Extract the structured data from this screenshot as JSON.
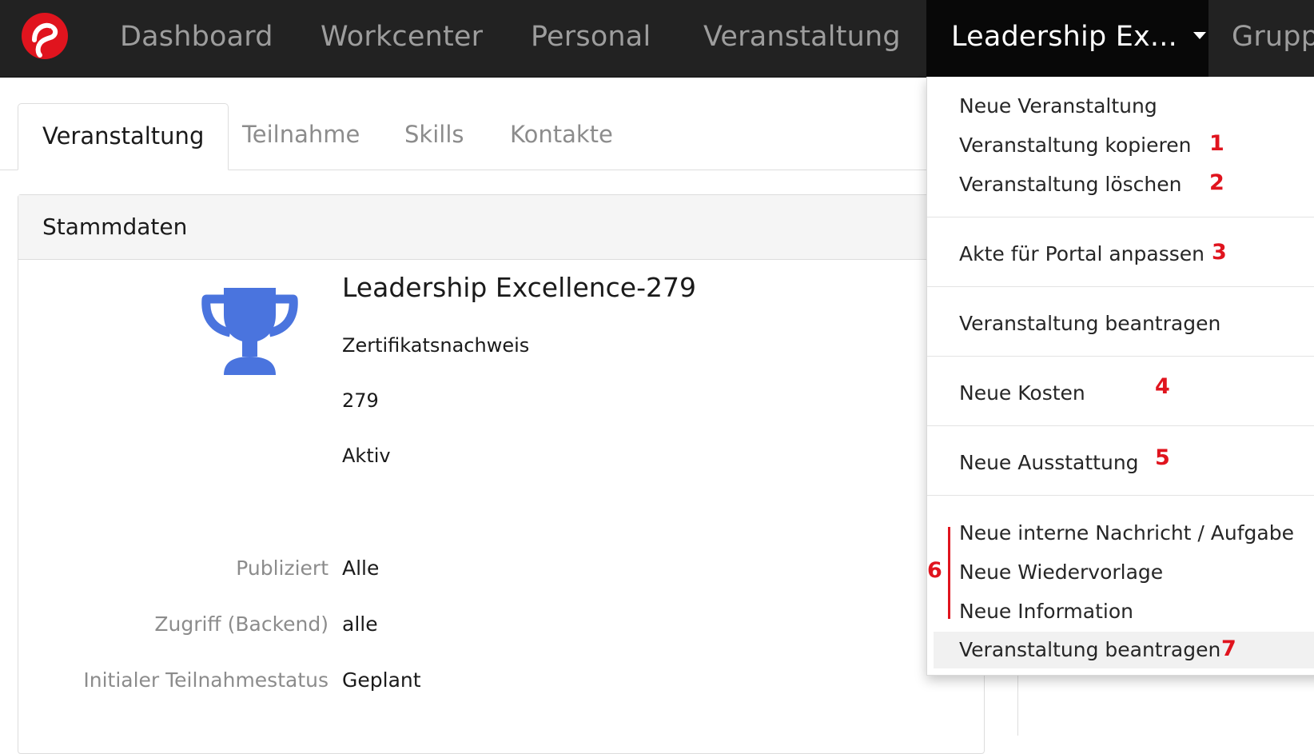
{
  "topnav": {
    "items": [
      {
        "label": "Dashboard"
      },
      {
        "label": "Workcenter"
      },
      {
        "label": "Personal"
      },
      {
        "label": "Veranstaltung"
      },
      {
        "label": "Leadership Ex..."
      },
      {
        "label": "Grupp"
      }
    ],
    "active_index": 4,
    "logo_color": "#e0141e"
  },
  "tabs": [
    {
      "label": "Veranstaltung",
      "active": true
    },
    {
      "label": "Teilnahme"
    },
    {
      "label": "Skills"
    },
    {
      "label": "Kontakte"
    }
  ],
  "panel": {
    "heading": "Stammdaten",
    "icon": "trophy-icon",
    "icon_color": "#4a74de",
    "title": "Leadership Excellence-279",
    "type": "Zertifikatsnachweis",
    "number": "279",
    "status": "Aktiv",
    "rows": [
      {
        "label": "Publiziert",
        "value": "Alle"
      },
      {
        "label": "Zugriff (Backend)",
        "value": "alle"
      },
      {
        "label": "Initialer Teilnahmestatus",
        "value": "Geplant"
      }
    ]
  },
  "dropdown": {
    "items": [
      {
        "label": "Neue Veranstaltung",
        "marker": ""
      },
      {
        "label": "Veranstaltung kopieren",
        "marker": "1"
      },
      {
        "label": "Veranstaltung löschen",
        "marker": "2"
      },
      {
        "label": "Akte für Portal anpassen",
        "marker": "3"
      },
      {
        "label": "Veranstaltung beantragen",
        "marker": ""
      },
      {
        "label": "Neue Kosten",
        "marker": "4"
      },
      {
        "label": "Neue Ausstattung",
        "marker": "5"
      },
      {
        "label": "Neue interne Nachricht / Aufgabe",
        "marker": ""
      },
      {
        "label": "Neue Wiedervorlage",
        "marker": ""
      },
      {
        "label": "Neue Information",
        "marker": ""
      },
      {
        "label": "Veranstaltung beantragen",
        "marker": "7"
      }
    ],
    "group_marker": "6",
    "annotation_color": "#e0141e"
  }
}
